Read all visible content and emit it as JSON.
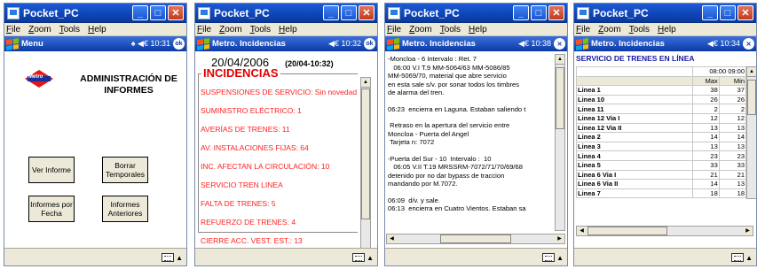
{
  "menubar": {
    "file": "File",
    "zoom": "Zoom",
    "tools": "Tools",
    "help": "Help"
  },
  "window_title": "Pocket_PC",
  "screens": [
    {
      "bar_title": "Menu",
      "status": "♠ ◀€ 10:31",
      "ok": "ok",
      "logo_text": "Metro",
      "admin_title": "ADMINISTRACIÓN DE INFORMES",
      "buttons": {
        "ver_informe": "Ver Informe",
        "borrar": "Borrar Temporales",
        "por_fecha": "Informes por Fecha",
        "anteriores": "Informes Anteriores"
      }
    },
    {
      "bar_title": "Metro. Incidencias",
      "status": "◀€ 10:32",
      "ok": "ok",
      "date": "20/04/2006",
      "date_sub": "(20/04-10:32)",
      "legend": "INCIDENCIAS",
      "items": [
        "SUSPENSIONES DE SERVICIO: Sin novedad",
        "SUMINISTRO ELÉCTRICO: 1",
        "AVERÍAS DE TRENES: 11",
        "AV. INSTALACIONES FIJAS: 64",
        "INC. AFECTAN LA CIRCULACIÓN: 10",
        "SERVICIO TREN LINEA",
        "FALTA DE TRENES: 5",
        "REFUERZO DE TRENES: 4",
        "CIERRE ACC. VEST. EST.: 13"
      ]
    },
    {
      "bar_title": "Metro. Incidencias",
      "status": "◀€ 10:38",
      "close": "✕",
      "paragraphs": [
        "-Moncloa - 6 Intervalo : Ret. 7\n   06:00 V.I T.9 MM-5064/63 MM-5086/85\nMM-5069/70, material que abre servicio\nen esta sale s/v. por sonar todos los timbres\nde alarma del tren.",
        "06:23  encierra en Laguna. Estaban saliendo t",
        " Retraso en la apertura del servicio entre\nMoncloa - Puerta del Angel\n Tarjeta n: 7072",
        "-Puerta del Sur - 10  Intervalo :  10\n   06:05 V.II T.19 MRSSRM-7072/71/70/69/68\ndetenido por no dar bypass de traccion\nmandando por M.7072.",
        "06:09  d/v. y sale.\n06:13  encierra en Cuatro Vientos. Estaban sa"
      ]
    },
    {
      "bar_title": "Metro. Incidencias",
      "status": "◀€ 10:34",
      "close": "✕",
      "grid_title": "SERVICIO DE TRENES EN LÍNEA",
      "time_header": "08:00 09:00",
      "max_label": "Max",
      "min_label": "Min",
      "rows": [
        {
          "name": "Linea 1",
          "max": "38",
          "min": "37"
        },
        {
          "name": "Linea 10",
          "max": "26",
          "min": "26"
        },
        {
          "name": "Linea 11",
          "max": "2",
          "min": "2"
        },
        {
          "name": "Linea 12 Via I",
          "max": "12",
          "min": "12"
        },
        {
          "name": "Linea 12 Via II",
          "max": "13",
          "min": "13"
        },
        {
          "name": "Linea 2",
          "max": "14",
          "min": "14"
        },
        {
          "name": "Linea 3",
          "max": "13",
          "min": "13"
        },
        {
          "name": "Linea 4",
          "max": "23",
          "min": "23"
        },
        {
          "name": "Linea 5",
          "max": "33",
          "min": "33"
        },
        {
          "name": "Linea 6 Via I",
          "max": "21",
          "min": "21"
        },
        {
          "name": "Linea 6 Via II",
          "max": "14",
          "min": "13"
        },
        {
          "name": "Linea 7",
          "max": "18",
          "min": "18"
        }
      ]
    }
  ],
  "colors": {
    "titlebar": "#0e44b5",
    "incidencias_red": "#ff2020",
    "grid_title_blue": "#1a1aa8"
  },
  "icons": [
    "app-icon",
    "minimize-icon",
    "maximize-icon",
    "close-icon",
    "windows-flag-icon",
    "ok-icon",
    "keyboard-icon",
    "metro-logo"
  ]
}
